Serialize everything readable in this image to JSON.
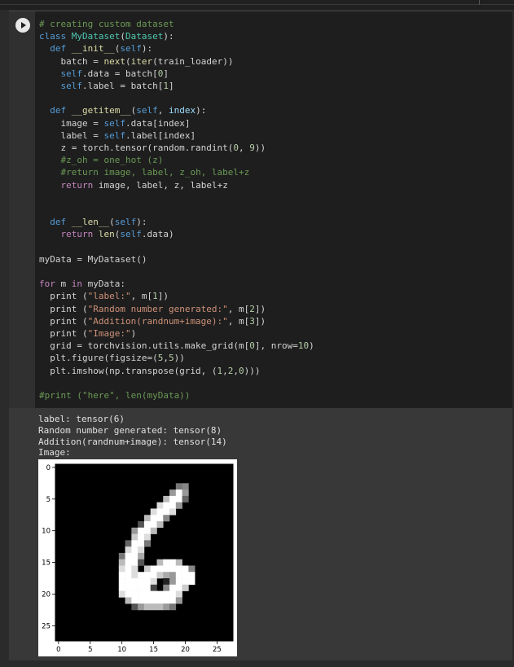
{
  "notebook": {
    "cell": {
      "run_button": "play-icon",
      "code_lines": [
        [
          [
            "tok-cmt",
            "# creating custom dataset"
          ]
        ],
        [
          [
            "tok-kw",
            "class "
          ],
          [
            "tok-cls",
            "MyDataset"
          ],
          [
            "",
            "("
          ],
          [
            "tok-cls",
            "Dataset"
          ],
          [
            "",
            "):"
          ]
        ],
        [
          [
            "",
            "  "
          ],
          [
            "tok-kw",
            "def "
          ],
          [
            "tok-fn",
            "__init__"
          ],
          [
            "",
            "("
          ],
          [
            "tok-self",
            "self"
          ],
          [
            "",
            "):"
          ]
        ],
        [
          [
            "",
            "    batch = "
          ],
          [
            "tok-fn",
            "next"
          ],
          [
            "",
            "("
          ],
          [
            "tok-fn",
            "iter"
          ],
          [
            "",
            "(train_loader))"
          ]
        ],
        [
          [
            "",
            "    "
          ],
          [
            "tok-self",
            "self"
          ],
          [
            "",
            ".data = batch["
          ],
          [
            "tok-num",
            "0"
          ],
          [
            "",
            "]"
          ]
        ],
        [
          [
            "",
            "    "
          ],
          [
            "tok-self",
            "self"
          ],
          [
            "",
            ".label = batch["
          ],
          [
            "tok-num",
            "1"
          ],
          [
            "",
            "]"
          ]
        ],
        [
          [
            "",
            ""
          ]
        ],
        [
          [
            "",
            "  "
          ],
          [
            "tok-kw",
            "def "
          ],
          [
            "tok-fn",
            "__getitem__"
          ],
          [
            "",
            "("
          ],
          [
            "tok-self",
            "self"
          ],
          [
            "",
            ", "
          ],
          [
            "tok-param",
            "index"
          ],
          [
            "",
            "):"
          ]
        ],
        [
          [
            "",
            "    image = "
          ],
          [
            "tok-self",
            "self"
          ],
          [
            "",
            ".data[index]"
          ]
        ],
        [
          [
            "",
            "    label = "
          ],
          [
            "tok-self",
            "self"
          ],
          [
            "",
            ".label[index]"
          ]
        ],
        [
          [
            "",
            "    z = torch.tensor(random.randint("
          ],
          [
            "tok-num",
            "0"
          ],
          [
            "",
            ", "
          ],
          [
            "tok-num",
            "9"
          ],
          [
            "",
            "))"
          ]
        ],
        [
          [
            "",
            "    "
          ],
          [
            "tok-cmt",
            "#z_oh = one_hot (z)"
          ]
        ],
        [
          [
            "",
            "    "
          ],
          [
            "tok-cmt",
            "#return image, label, z_oh, label+z"
          ]
        ],
        [
          [
            "",
            "    "
          ],
          [
            "tok-kw2",
            "return"
          ],
          [
            "",
            " image, label, z, label+z"
          ]
        ],
        [
          [
            "",
            ""
          ]
        ],
        [
          [
            "",
            ""
          ]
        ],
        [
          [
            "",
            "  "
          ],
          [
            "tok-kw",
            "def "
          ],
          [
            "tok-fn",
            "__len__"
          ],
          [
            "",
            "("
          ],
          [
            "tok-self",
            "self"
          ],
          [
            "",
            "):"
          ]
        ],
        [
          [
            "",
            "    "
          ],
          [
            "tok-kw2",
            "return "
          ],
          [
            "tok-fn",
            "len"
          ],
          [
            "",
            "("
          ],
          [
            "tok-self",
            "self"
          ],
          [
            "",
            ".data)"
          ]
        ],
        [
          [
            "",
            ""
          ]
        ],
        [
          [
            "",
            "myData = MyDataset()"
          ]
        ],
        [
          [
            "",
            ""
          ]
        ],
        [
          [
            "tok-kw2",
            "for"
          ],
          [
            "",
            " m "
          ],
          [
            "tok-kw2",
            "in"
          ],
          [
            "",
            " myData:"
          ]
        ],
        [
          [
            "",
            "  print ("
          ],
          [
            "tok-str",
            "\"label:\""
          ],
          [
            "",
            ", m["
          ],
          [
            "tok-num",
            "1"
          ],
          [
            "",
            "])"
          ]
        ],
        [
          [
            "",
            "  print ("
          ],
          [
            "tok-str",
            "\"Random number generated:\""
          ],
          [
            "",
            ", m["
          ],
          [
            "tok-num",
            "2"
          ],
          [
            "",
            "])"
          ]
        ],
        [
          [
            "",
            "  print ("
          ],
          [
            "tok-str",
            "\"Addition(randnum+image):\""
          ],
          [
            "",
            ", m["
          ],
          [
            "tok-num",
            "3"
          ],
          [
            "",
            "])"
          ]
        ],
        [
          [
            "",
            "  print ("
          ],
          [
            "tok-str",
            "\"Image:\""
          ],
          [
            "",
            ")"
          ]
        ],
        [
          [
            "",
            "  grid = torchvision.utils.make_grid(m["
          ],
          [
            "tok-num",
            "0"
          ],
          [
            "",
            "], nrow="
          ],
          [
            "tok-num",
            "10"
          ],
          [
            "",
            ")"
          ]
        ],
        [
          [
            "",
            "  plt.figure(figsize=("
          ],
          [
            "tok-num",
            "5"
          ],
          [
            "",
            ","
          ],
          [
            "tok-num",
            "5"
          ],
          [
            "",
            "))"
          ]
        ],
        [
          [
            "",
            "  plt.imshow(np.transpose(grid, ("
          ],
          [
            "tok-num",
            "1"
          ],
          [
            "",
            ","
          ],
          [
            "tok-num",
            "2"
          ],
          [
            "",
            ","
          ],
          [
            "tok-num",
            "0"
          ],
          [
            "",
            ")))"
          ]
        ],
        [
          [
            "",
            ""
          ]
        ],
        [
          [
            "tok-cmt",
            "#print (\"here\", len(myData))"
          ]
        ]
      ]
    },
    "output": {
      "lines": [
        "label: tensor(6)",
        "Random number generated: tensor(8)",
        "Addition(randnum+image): tensor(14)",
        "Image:"
      ],
      "figure": {
        "x_ticks": [
          "0",
          "5",
          "10",
          "15",
          "20",
          "25"
        ],
        "y_ticks": [
          "0",
          "5",
          "10",
          "15",
          "20",
          "25"
        ],
        "image_rows": [
          "............................",
          "............................",
          "............................",
          "...................78........",
          "..................9f9........",
          ".................bff6........",
          "................dff9.........",
          "...............dffd..........",
          "..............bff8...........",
          ".............5ffb............",
          "............9ffb.............",
          "............cfd..............",
          "...........6ff7..............",
          "...........dfd...............",
          "..........7ffa...............",
          "..........bff5..bffb.........",
          "..........dfd.cffffff8.......",
          "..........ffdfffca9fff.......",
          "..........fffffd.29fff.......",
          "..........fffff4.8ffc........",
          "..........dffffffffd.........",
          "...........bfffffff9.........",
          "............59bbb97..........",
          "............................",
          "............................",
          "............................",
          "............................",
          "............................"
        ]
      }
    }
  }
}
